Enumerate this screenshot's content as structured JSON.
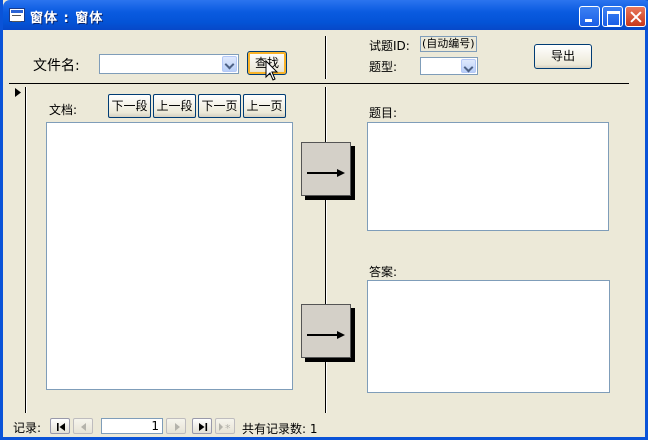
{
  "window": {
    "title": "窗体 : 窗体"
  },
  "top": {
    "filename_label": "文件名:",
    "filename_value": "",
    "search_button": "查找",
    "question_id_label": "试题ID:",
    "question_id_value": "(自动编号)",
    "type_label": "题型:",
    "type_value": "",
    "export_button": "导出"
  },
  "left": {
    "doc_label": "文档:",
    "buttons": [
      "下一段",
      "上一段",
      "下一页",
      "上一页"
    ],
    "doc_text": ""
  },
  "right": {
    "question_label": "题目:",
    "question_text": "",
    "answer_label": "答案:",
    "answer_text": ""
  },
  "nav": {
    "records_label": "记录:",
    "current_record": "1",
    "total_label": "共有记录数: 1"
  },
  "icons": {
    "title": "form-icon",
    "arrow": "right-arrow-icon"
  }
}
